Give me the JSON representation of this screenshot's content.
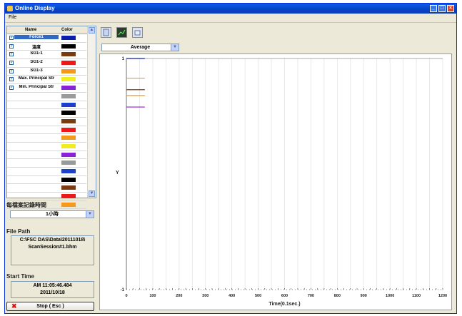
{
  "window": {
    "title": "Online Display"
  },
  "menu": {
    "file": "File"
  },
  "channel_list": {
    "headers": {
      "name": "Name",
      "color": "Color"
    },
    "rows": [
      {
        "name": "Force1",
        "color": "#0a1fb0",
        "checked": true,
        "selected": true
      },
      {
        "name": "溫度",
        "color": "#000000",
        "checked": true
      },
      {
        "name": "SG1-1",
        "color": "#7a3a12",
        "checked": true
      },
      {
        "name": "SG1-2",
        "color": "#e81a1a",
        "checked": true
      },
      {
        "name": "SG1-3",
        "color": "#f39a1c",
        "checked": true
      },
      {
        "name": "Max. Principal Str",
        "color": "#f0ee22",
        "checked": true
      },
      {
        "name": "Min. Principal Str",
        "color": "#8a22d8",
        "checked": true
      },
      {
        "name": "",
        "color": "#9a9a9a",
        "checked": false
      },
      {
        "name": "",
        "color": "#1d3fd0",
        "checked": false
      },
      {
        "name": "",
        "color": "#000000",
        "checked": false
      },
      {
        "name": "",
        "color": "#7a3a12",
        "checked": false
      },
      {
        "name": "",
        "color": "#e81a1a",
        "checked": false
      },
      {
        "name": "",
        "color": "#f39a1c",
        "checked": false
      },
      {
        "name": "",
        "color": "#f0ee22",
        "checked": false
      },
      {
        "name": "",
        "color": "#8a22d8",
        "checked": false
      },
      {
        "name": "",
        "color": "#9a9a9a",
        "checked": false
      },
      {
        "name": "",
        "color": "#1d3fd0",
        "checked": false
      },
      {
        "name": "",
        "color": "#000000",
        "checked": false
      },
      {
        "name": "",
        "color": "#7a3a12",
        "checked": false
      },
      {
        "name": "",
        "color": "#e81a1a",
        "checked": false
      },
      {
        "name": "",
        "color": "#f39a1c",
        "checked": false
      }
    ]
  },
  "record": {
    "label": "每檔案記錄時間",
    "value": "1小時"
  },
  "file_path": {
    "label": "File Path",
    "line1": "C:\\FSC DAS\\Data\\20111018\\",
    "line2": "ScanSession#1.bhm"
  },
  "start_time": {
    "label": "Start Time",
    "line1": "AM 11:05:46.484",
    "line2": "2011/10/18"
  },
  "stop_button": {
    "label": "Stop ( Esc )"
  },
  "mode_select": {
    "value": "Average"
  },
  "icons": {
    "toolbar": [
      "copy-icon",
      "chart-icon",
      "print-icon"
    ]
  },
  "chart_data": {
    "type": "line",
    "xlabel": "Time(0.1sec.)",
    "ylabel": "Y",
    "xlim": [
      0,
      1200
    ],
    "ylim": [
      -1,
      1
    ],
    "x_ticks": [
      "0",
      "100",
      "200",
      "300",
      "400",
      "500",
      "600",
      "700",
      "800",
      "900",
      "1000",
      "1100",
      "1200"
    ],
    "y_ticks": [
      "1",
      "-1"
    ],
    "grid": true,
    "series": [
      {
        "color": "#0a1fb0",
        "x": [
          0,
          70
        ],
        "y": [
          1,
          1
        ]
      },
      {
        "color": "#f39a1c",
        "x": [
          0,
          70
        ],
        "y": [
          0.83,
          0.83
        ]
      },
      {
        "color": "#7a3a12",
        "x": [
          0,
          70
        ],
        "y": [
          0.73,
          0.73
        ]
      },
      {
        "color": "#f39a1c",
        "x": [
          0,
          70
        ],
        "y": [
          0.68,
          0.68
        ]
      },
      {
        "color": "#8a22d8",
        "x": [
          0,
          70
        ],
        "y": [
          0.58,
          0.58
        ]
      }
    ]
  }
}
